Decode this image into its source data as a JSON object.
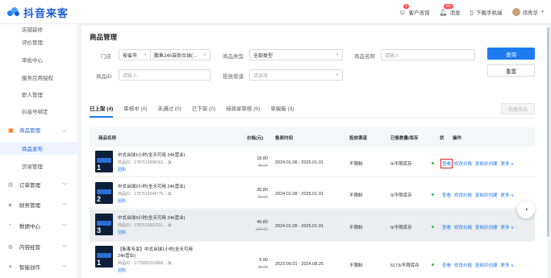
{
  "header": {
    "logo_text": "抖音来客",
    "service_label": "客户咨询",
    "service_badge": "2",
    "message_label": "消息",
    "message_badge": "99+",
    "download_label": "下载手机端",
    "user_name": "邓秀华"
  },
  "sidebar": {
    "items": [
      {
        "label": "店铺装修",
        "type": "sub"
      },
      {
        "label": "评价管理",
        "type": "sub"
      },
      {
        "label": "审批中心",
        "type": "sub"
      },
      {
        "label": "服务应用授权",
        "type": "sub"
      },
      {
        "label": "职人管理",
        "type": "sub"
      },
      {
        "label": "抖音号绑定",
        "type": "sub"
      },
      {
        "label": "商品管理",
        "type": "group",
        "icon": "bag-icon",
        "expanded": true
      },
      {
        "label": "商品发布",
        "type": "sub",
        "active": true
      },
      {
        "label": "货架管理",
        "type": "sub"
      },
      {
        "label": "订单管理",
        "type": "group",
        "icon": "order-icon"
      },
      {
        "label": "财务管理",
        "type": "group",
        "icon": "finance-icon"
      },
      {
        "label": "数据中心",
        "type": "group",
        "icon": "data-icon"
      },
      {
        "label": "内容经营",
        "type": "group",
        "icon": "content-icon"
      },
      {
        "label": "智能创作",
        "type": "group",
        "icon": "ai-icon"
      }
    ]
  },
  "page": {
    "title": "商品管理"
  },
  "filters": {
    "store_label": "门店",
    "store_scope": "按省市",
    "store_value": "鹏鱼24h自助台球(…",
    "type_label": "商品类型",
    "type_value": "全部类型",
    "name_label": "商品名称",
    "name_placeholder": "请输入",
    "id_label": "商品ID",
    "id_placeholder": "请输入",
    "channel_label": "投放渠道",
    "channel_placeholder": "请选择",
    "query_button": "查询",
    "reset_button": "重置"
  },
  "tabs": [
    "已上架 (4)",
    "审核中 (0)",
    "未通过 (0)",
    "已下架 (0)",
    "待商家审核 (0)",
    "草稿箱 (3)"
  ],
  "batch_button": "批量商品",
  "table": {
    "headers": [
      "商品名称",
      "价格(元)",
      "售卖时间",
      "投放渠道",
      "已售数量/库存",
      "状",
      "操作"
    ],
    "rows": [
      {
        "name": "中式台球1小时(全天可用 24h营业)",
        "id": "商品ID：1787510698162…",
        "tag": "团购",
        "price": "18.80",
        "orig": "45.00",
        "time": "2024.01.08 - 2025.01.01",
        "channel": "不限制",
        "stock": "0/不限库存",
        "thumb_num": "1"
      },
      {
        "name": "中式台球2小时(全天可用 24h营业)",
        "id": "商品ID：1787510544775…",
        "tag": "团购",
        "price": "35.80",
        "orig": "90.00",
        "time": "2024.01.08 - 2025.01.01",
        "channel": "不限制",
        "stock": "0/不限库存",
        "thumb_num": "2"
      },
      {
        "name": "中式台球3小时(全天可用 24h营业)",
        "id": "商品ID：1787510663301…",
        "tag": "团购",
        "price": "49.80",
        "orig": "135.00",
        "time": "2024.01.08 - 2025.01.01",
        "channel": "不限制",
        "stock": "0/不限库存",
        "thumb_num": "3"
      },
      {
        "name": "【新客专享】中式台球1小时(全天可用 24h营业)",
        "id": "商品ID：1775802316868…",
        "tag": "团购",
        "price": "9.90",
        "orig": "45.00",
        "time": "2023.09.01 - 2024.08.25",
        "channel": "不限制",
        "stock": "6173/不限库存",
        "thumb_num": "1"
      }
    ],
    "actions": {
      "view": "查看",
      "edit": "修改价格",
      "copy": "复制并创建",
      "more": "更多"
    }
  }
}
